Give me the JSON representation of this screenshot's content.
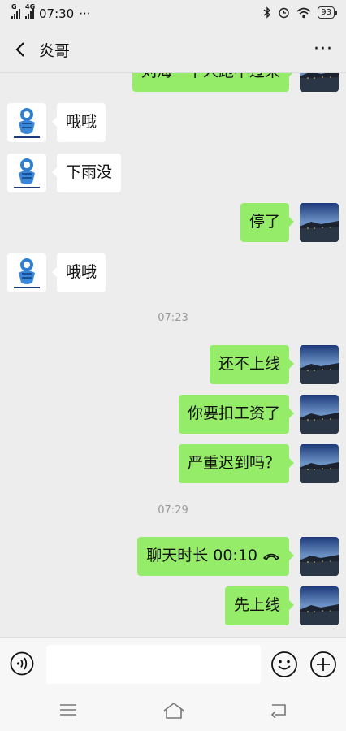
{
  "status": {
    "network": "4G",
    "time": "07:30",
    "more": "···",
    "battery": "93"
  },
  "header": {
    "title": "炎哥",
    "more": "···"
  },
  "messages": [
    {
      "side": "sent",
      "text": "刘海一下人跑不过来"
    },
    {
      "side": "recv",
      "text": "哦哦"
    },
    {
      "side": "recv",
      "text": "下雨没"
    },
    {
      "side": "sent",
      "text": "停了"
    },
    {
      "side": "recv",
      "text": "哦哦"
    },
    {
      "side": "sent",
      "text": "还不上线"
    },
    {
      "side": "sent",
      "text": "你要扣工资了"
    },
    {
      "side": "sent",
      "text": "严重迟到吗？"
    },
    {
      "side": "sent",
      "text": "聊天时长 00:10",
      "icon": "phone-hangup-icon"
    },
    {
      "side": "sent",
      "text": "先上线"
    }
  ],
  "timestamps": [
    "07:23",
    "07:29"
  ],
  "input": {
    "placeholder": ""
  },
  "colors": {
    "sent_bubble": "#95ec69",
    "recv_bubble": "#ffffff",
    "background": "#ededed"
  }
}
